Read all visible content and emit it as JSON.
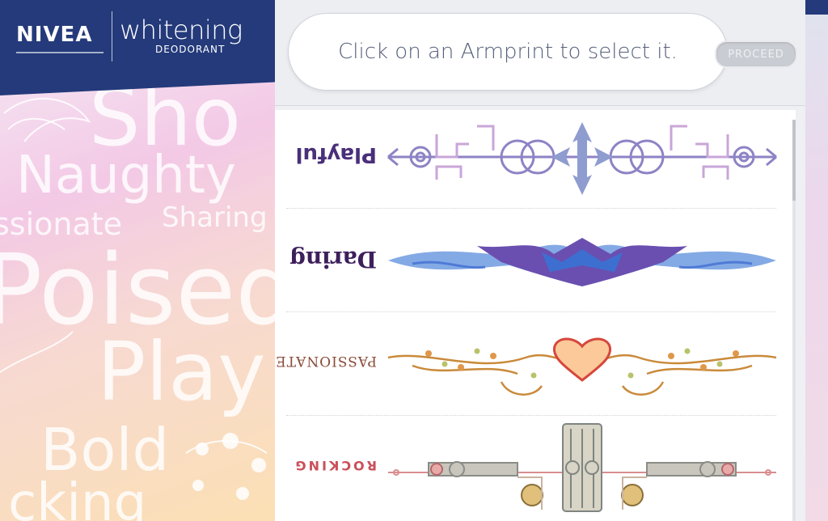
{
  "brand": {
    "logo_text": "NIVEA",
    "product_name": "whitening",
    "product_sub": "DEODORANT"
  },
  "background_words": [
    "Sho",
    "Naughty",
    "ssionate",
    "Sharing",
    "Poised",
    "Play",
    "Bold",
    "cking"
  ],
  "header": {
    "instruction": "Click on an Armprint to select it.",
    "proceed_label": "PROCEED"
  },
  "armprints": [
    {
      "label": "Playful",
      "color": "#4a2f7a",
      "accent": "#8e83c5"
    },
    {
      "label": "Daring",
      "color": "#3d1f5c",
      "accent": "#4f7bd6"
    },
    {
      "label": "PASSIONATE",
      "color": "#8a4a38",
      "accent": "#d9a84f"
    },
    {
      "label": "ROCKING",
      "color": "#c9505c",
      "accent": "#8a8c86"
    }
  ],
  "colors": {
    "brand_blue": "#243a7b",
    "panel_bg": "#eef0f4",
    "text_muted": "#55607a"
  }
}
